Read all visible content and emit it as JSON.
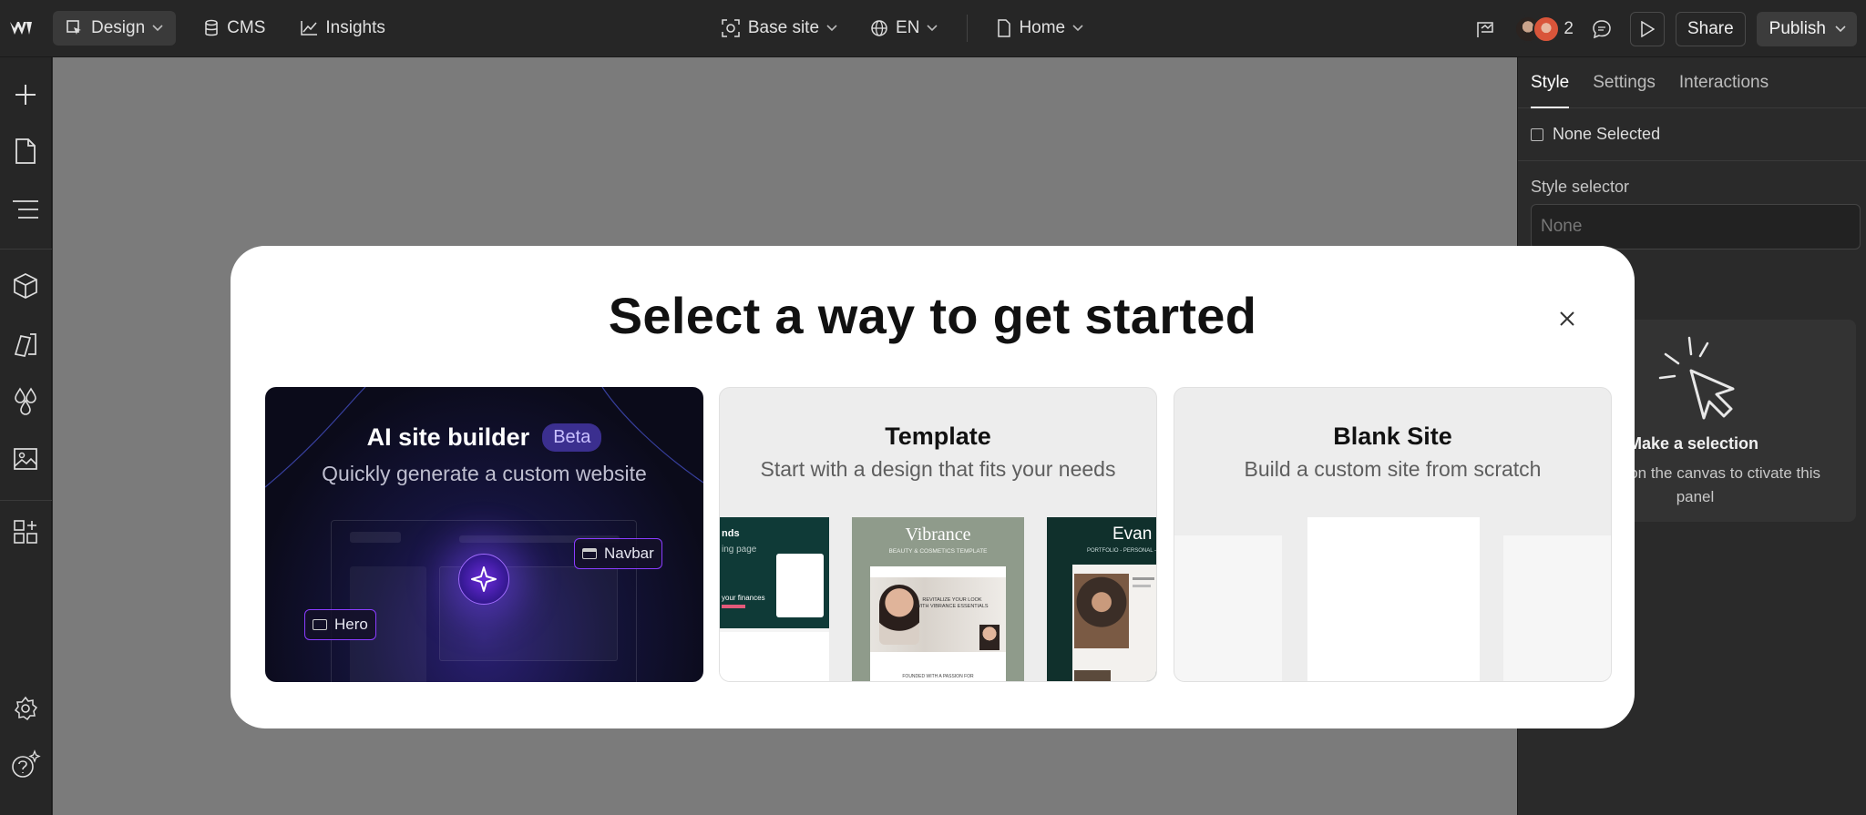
{
  "topbar": {
    "design_label": "Design",
    "cms_label": "CMS",
    "insights_label": "Insights",
    "site_label": "Base site",
    "locale_label": "EN",
    "page_label": "Home",
    "collaborator_count": "2",
    "share_label": "Share",
    "publish_label": "Publish"
  },
  "right_panel": {
    "tabs": [
      "Style",
      "Settings",
      "Interactions"
    ],
    "none_selected": "None Selected",
    "style_selector_label": "Style selector",
    "style_selector_placeholder": "None",
    "empty_title": "Make a selection",
    "empty_text": "element on the canvas to ctivate this panel"
  },
  "modal": {
    "title": "Select a way to get started",
    "ai": {
      "title": "AI site builder",
      "badge": "Beta",
      "subtitle": "Quickly generate a custom website",
      "chip_navbar": "Navbar",
      "chip_hero": "Hero"
    },
    "template": {
      "title": "Template",
      "subtitle": "Start with a design that fits your needs",
      "thumb_left_text": "nds",
      "thumb_left_sub": "ing page",
      "thumb_left_finance": "your finances",
      "thumb_mid_title": "Vibrance",
      "thumb_mid_sub": "BEAUTY & COSMETICS TEMPLATE",
      "thumb_mid_head": "REVITALIZE YOUR LOOK WITH VIBRANCE ESSENTIALS",
      "thumb_mid_foot": "FOUNDED WITH A PASSION FOR",
      "thumb_right_title": "Evan",
      "thumb_right_sub": "PORTFOLIO - PERSONAL -"
    },
    "blank": {
      "title": "Blank Site",
      "subtitle": "Build a custom site from scratch"
    }
  },
  "colors": {
    "chrome_bg": "#262626",
    "canvas_bg": "#7b7b7b",
    "ai_accent": "#8a3cff",
    "template_green": "#0f3a37",
    "vibrance_bg": "#8f9b8b"
  }
}
